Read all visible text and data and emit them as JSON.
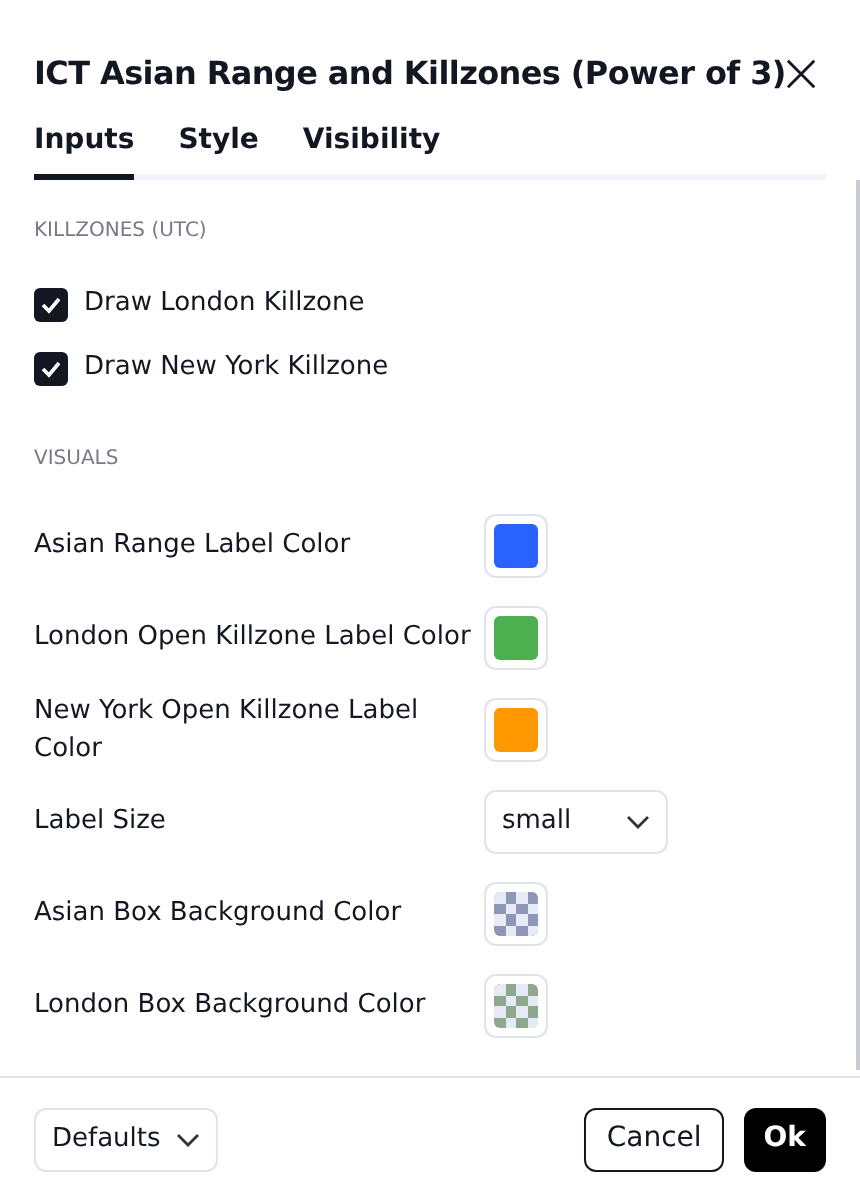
{
  "title": "ICT Asian Range and Killzones (Power of 3)",
  "tabs": [
    {
      "label": "Inputs",
      "selected": true
    },
    {
      "label": "Style",
      "selected": false
    },
    {
      "label": "Visibility",
      "selected": false
    }
  ],
  "sections": [
    {
      "heading": "KILLZONES (UTC)",
      "rows": [
        {
          "kind": "checkbox",
          "label": "Draw London Killzone",
          "checked": true
        },
        {
          "kind": "checkbox",
          "label": "Draw New York Killzone",
          "checked": true
        }
      ]
    },
    {
      "heading": "VISUALS",
      "rows": [
        {
          "kind": "color",
          "label": "Asian Range Label Color",
          "color": "#2962ff"
        },
        {
          "kind": "color",
          "label": "London Open Killzone Label Color",
          "color": "#4caf50"
        },
        {
          "kind": "color",
          "label": "New York Open Killzone Label Color",
          "color": "#ff9800"
        },
        {
          "kind": "select",
          "label": "Label Size",
          "value": "small"
        },
        {
          "kind": "translucent_color",
          "label": "Asian Box Background Color",
          "color": "#8e97b8"
        },
        {
          "kind": "translucent_color",
          "label": "London Box Background Color",
          "color": "#8ea890"
        }
      ]
    }
  ],
  "footer": {
    "defaults": "Defaults",
    "cancel": "Cancel",
    "ok": "Ok"
  }
}
